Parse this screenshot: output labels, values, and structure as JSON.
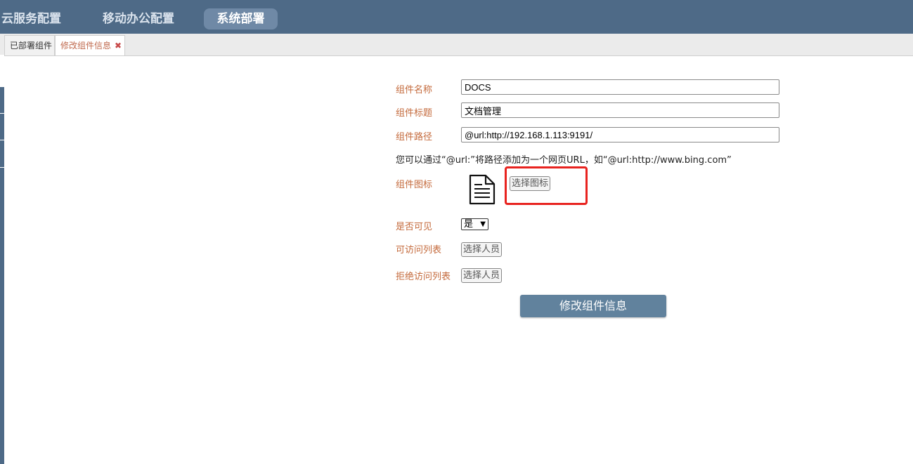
{
  "topnav": {
    "items": [
      "云服务配置",
      "移动办公配置"
    ],
    "active": "系统部署"
  },
  "tabs": {
    "deployed": "已部署组件",
    "edit": "修改组件信息",
    "close_symbol": "✖"
  },
  "form": {
    "name_label": "组件名称",
    "name_value": "DOCS",
    "title_label": "组件标题",
    "title_value": "文档管理",
    "path_label": "组件路径",
    "path_value": "@url:http://192.168.1.113:9191/",
    "hint": "您可以通过“@url:”将路径添加为一个网页URL，如“@url:http://www.bing.com”",
    "icon_label": "组件图标",
    "icon_name": "document-icon",
    "choose_icon": "选择图标",
    "visible_label": "是否可见",
    "visible_value": "是",
    "access_label": "可访问列表",
    "access_button": "选择人员",
    "deny_label": "拒绝访问列表",
    "deny_button": "选择人员",
    "submit": "修改组件信息"
  },
  "colors": {
    "header": "#4e6a87",
    "active_nav": "#6f89a6",
    "label": "#c46a3c",
    "submit": "#61829d",
    "highlight": "#e8231f"
  }
}
